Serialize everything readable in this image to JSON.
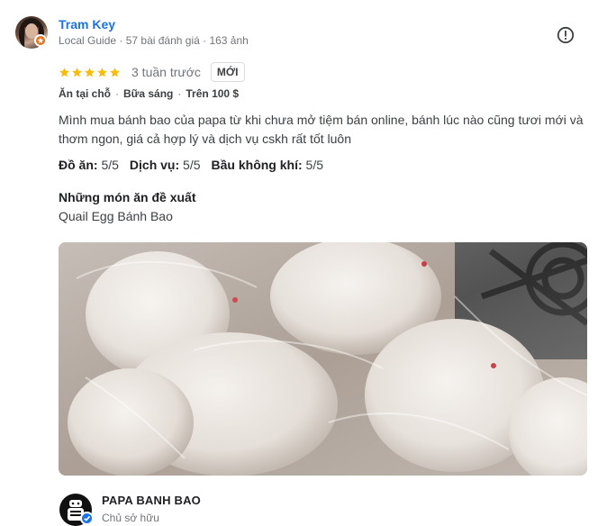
{
  "review": {
    "author": {
      "name": "Tram Key",
      "meta": "Local Guide · 57 bài đánh giá · 163 ảnh"
    },
    "rating": 5,
    "time_ago": "3 tuần trước",
    "new_badge": "MỚI",
    "tags": [
      "Ăn tại chỗ",
      "Bữa sáng",
      "Trên 100 $"
    ],
    "text": "Mình mua bánh bao của papa từ khi chưa mở tiệm bán online, bánh lúc nào cũng tươi mới và thơm ngon, giá cả hợp lý và dịch vụ cskh rất tốt luôn",
    "attributes": [
      {
        "label": "Đồ ăn:",
        "value": "5/5"
      },
      {
        "label": "Dịch vụ:",
        "value": "5/5"
      },
      {
        "label": "Bầu không khí:",
        "value": "5/5"
      }
    ],
    "recommended_title": "Những món ăn đề xuất",
    "recommended_dish": "Quail Egg Bánh Bao"
  },
  "owner": {
    "name": "PAPA BANH BAO",
    "role": "Chủ sở hữu"
  },
  "colors": {
    "link_blue": "#1a73e8",
    "star": "#fbbc04",
    "guide_badge": "#e8711a",
    "muted": "#70757a"
  },
  "icons": [
    "local-guide-badge-icon",
    "report-icon",
    "star-icon",
    "verified-icon"
  ]
}
